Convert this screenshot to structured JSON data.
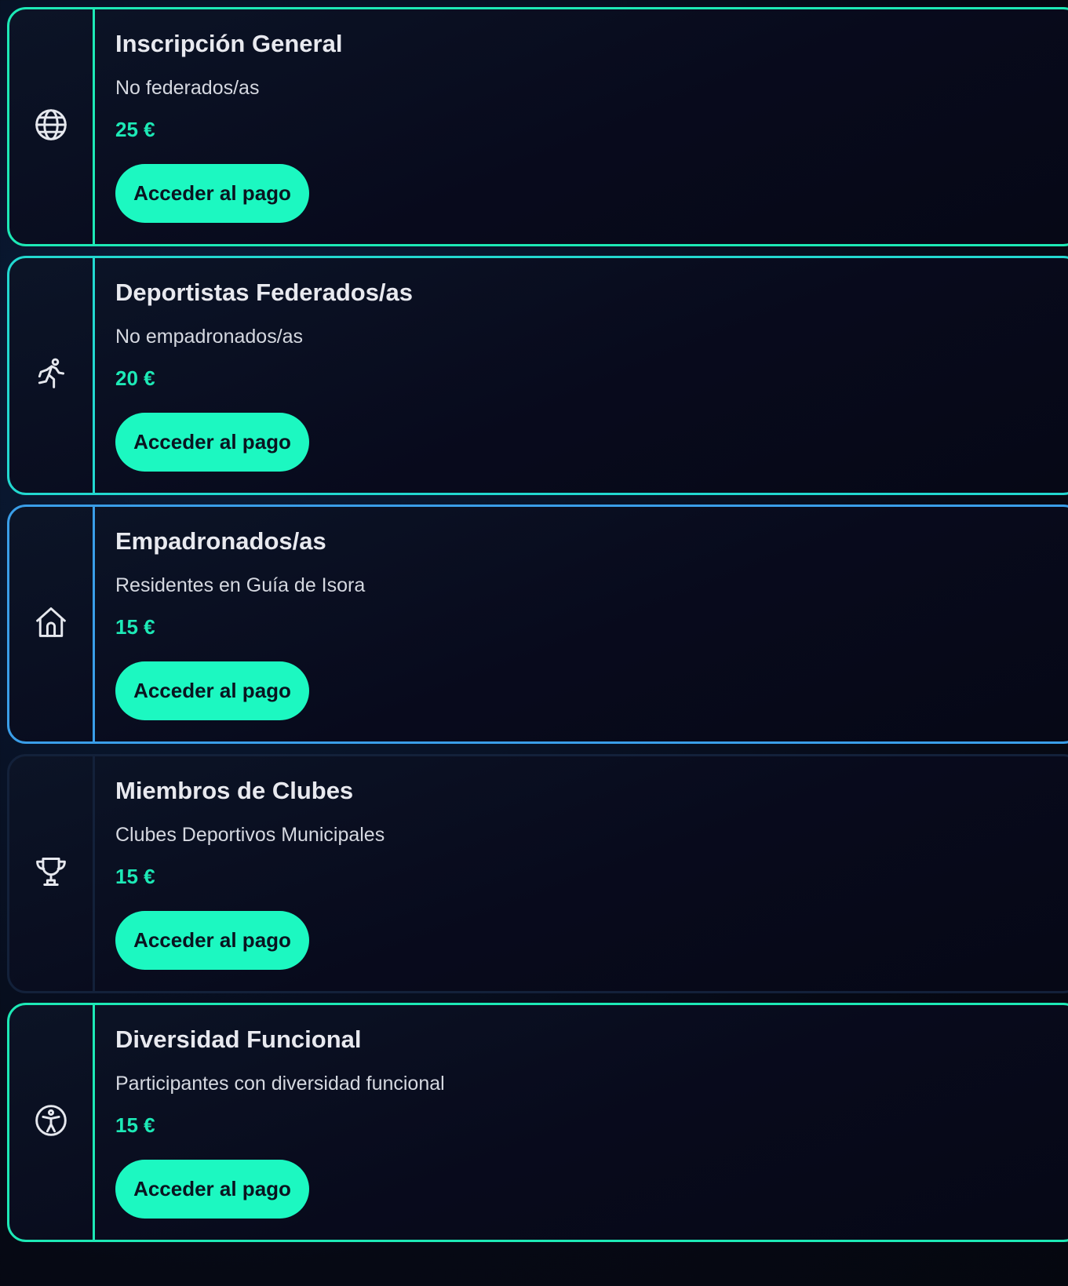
{
  "pay_button_label": "Acceder al pago",
  "colors": {
    "accent": "#1de9b6",
    "button_bg": "#1cf8c1",
    "price": "#1de9b6",
    "background": "#060914"
  },
  "cards": [
    {
      "title": "Inscripción General",
      "subtitle": "No federados/as",
      "price": "25 €",
      "icon": "globe-icon",
      "border_color": "#1de9b6"
    },
    {
      "title": "Deportistas Federados/as",
      "subtitle": "No empadronados/as",
      "price": "20 €",
      "icon": "runner-icon",
      "border_color": "#22d8d0"
    },
    {
      "title": "Empadronados/as",
      "subtitle": "Residentes en Guía de Isora",
      "price": "15 €",
      "icon": "home-icon",
      "border_color": "#3a9ee8"
    },
    {
      "title": "Miembros de Clubes",
      "subtitle": "Clubes Deportivos Municipales",
      "price": "15 €",
      "icon": "trophy-icon",
      "border_color": "#13213a"
    },
    {
      "title": "Diversidad Funcional",
      "subtitle": "Participantes con diversidad funcional",
      "price": "15 €",
      "icon": "accessibility-icon",
      "border_color": "#1de9b6"
    }
  ]
}
